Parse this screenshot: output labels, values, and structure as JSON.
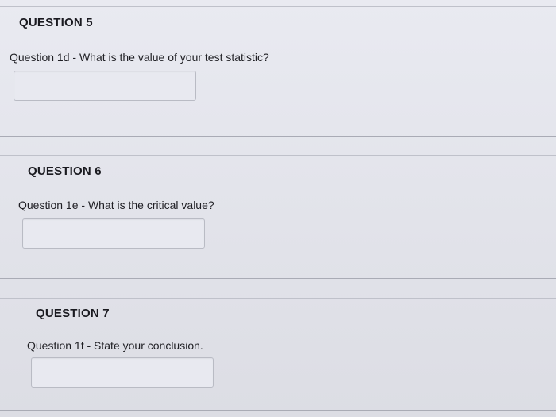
{
  "questions": [
    {
      "title": "QUESTION 5",
      "text": "Question 1d - What is the value of your test statistic?",
      "answer_value": ""
    },
    {
      "title": "QUESTION 6",
      "text": "Question 1e - What is the critical value?",
      "answer_value": ""
    },
    {
      "title": "QUESTION 7",
      "text": "Question 1f - State your conclusion.",
      "answer_value": ""
    }
  ]
}
